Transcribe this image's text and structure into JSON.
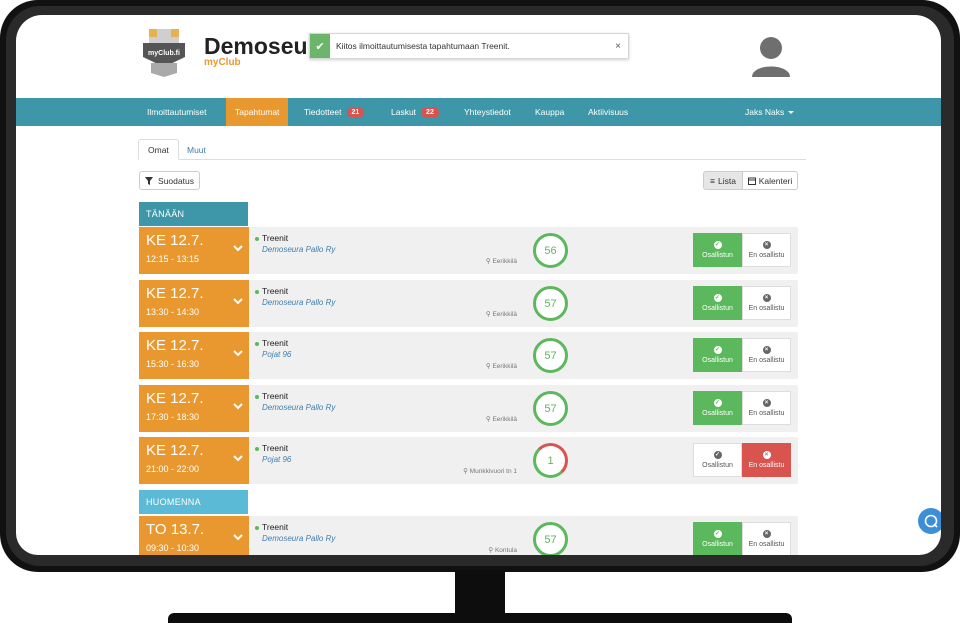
{
  "header": {
    "logo_text": "myClub.fi",
    "brand_title": "Demoseur",
    "brand_subtitle": "myClub",
    "toast": {
      "message": "Kiitos ilmoittautumisesta tapahtumaan Treenit.",
      "close": "×"
    }
  },
  "nav": {
    "items": [
      {
        "label": "Ilmoittautumiset"
      },
      {
        "label": "Tapahtumat"
      },
      {
        "label": "Tiedotteet",
        "badge": "21"
      },
      {
        "label": "Laskut",
        "badge": "22"
      },
      {
        "label": "Yhteystiedot"
      },
      {
        "label": "Kauppa"
      },
      {
        "label": "Aktiivisuus"
      }
    ],
    "active": "Tapahtumat",
    "user": "Jaks Naks"
  },
  "tabs": {
    "mine": "Omat",
    "other": "Muut"
  },
  "toolbar": {
    "filter": "Suodatus",
    "list": "Lista",
    "calendar": "Kalenteri"
  },
  "sections": {
    "today": "TÄNÄÄN",
    "tomorrow": "HUOMENNA"
  },
  "events": [
    {
      "day": "KE 12.7.",
      "time": "12:15 - 13:15",
      "title": "Treenit",
      "group": "Demoseura Pallo Ry",
      "location": "Eerikkilä",
      "count": "56",
      "attending": true
    },
    {
      "day": "KE 12.7.",
      "time": "13:30 - 14:30",
      "title": "Treenit",
      "group": "Demoseura Pallo Ry",
      "location": "Eerikkilä",
      "count": "57",
      "attending": true
    },
    {
      "day": "KE 12.7.",
      "time": "15:30 - 16:30",
      "title": "Treenit",
      "group": "Pojat 96",
      "location": "Eerikkilä",
      "count": "57",
      "attending": true
    },
    {
      "day": "KE 12.7.",
      "time": "17:30 - 18:30",
      "title": "Treenit",
      "group": "Demoseura Pallo Ry",
      "location": "Eerikkilä",
      "count": "57",
      "attending": true
    },
    {
      "day": "KE 12.7.",
      "time": "21:00 - 22:00",
      "title": "Treenit",
      "group": "Pojat 96",
      "location": "Munkkivuori tn 1",
      "count": "1",
      "attending": false
    },
    {
      "day": "TO 13.7.",
      "time": "09:30 - 10:30",
      "title": "Treenit",
      "group": "Demoseura Pallo Ry",
      "location": "Kontula",
      "count": "57",
      "attending": true
    }
  ],
  "attend_labels": {
    "yes": "Osallistun",
    "no": "En osallistu"
  },
  "colors": {
    "nav": "#3e97a8",
    "accent": "#e8982f",
    "today": "#3e97a8",
    "tomorrow": "#5bbad5",
    "green": "#5cb85c",
    "red": "#d9534f"
  }
}
